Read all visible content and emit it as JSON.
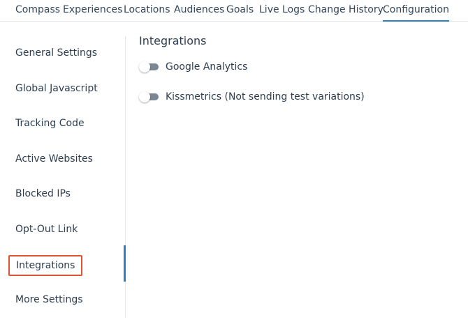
{
  "top_nav": {
    "tabs": [
      {
        "label": "Compass"
      },
      {
        "label": "Experiences"
      },
      {
        "label": "Locations"
      },
      {
        "label": "Audiences"
      },
      {
        "label": "Goals"
      },
      {
        "label": "Live Logs"
      },
      {
        "label": "Change History"
      },
      {
        "label": "Configuration",
        "active": true
      }
    ]
  },
  "sidebar": {
    "items": [
      {
        "label": "General Settings"
      },
      {
        "label": "Global Javascript"
      },
      {
        "label": "Tracking Code"
      },
      {
        "label": "Active Websites"
      },
      {
        "label": "Blocked IPs"
      },
      {
        "label": "Opt-Out Link"
      },
      {
        "label": "Integrations",
        "active": true
      },
      {
        "label": "More Settings"
      }
    ]
  },
  "main": {
    "title": "Integrations",
    "integrations": [
      {
        "label": "Google Analytics",
        "enabled": false
      },
      {
        "label": "Kissmetrics (Not sending test variations)",
        "enabled": false
      }
    ]
  },
  "colors": {
    "accent": "#2f7ec2",
    "highlight_border": "#e0532c",
    "toggle_off": "#7b8793"
  }
}
